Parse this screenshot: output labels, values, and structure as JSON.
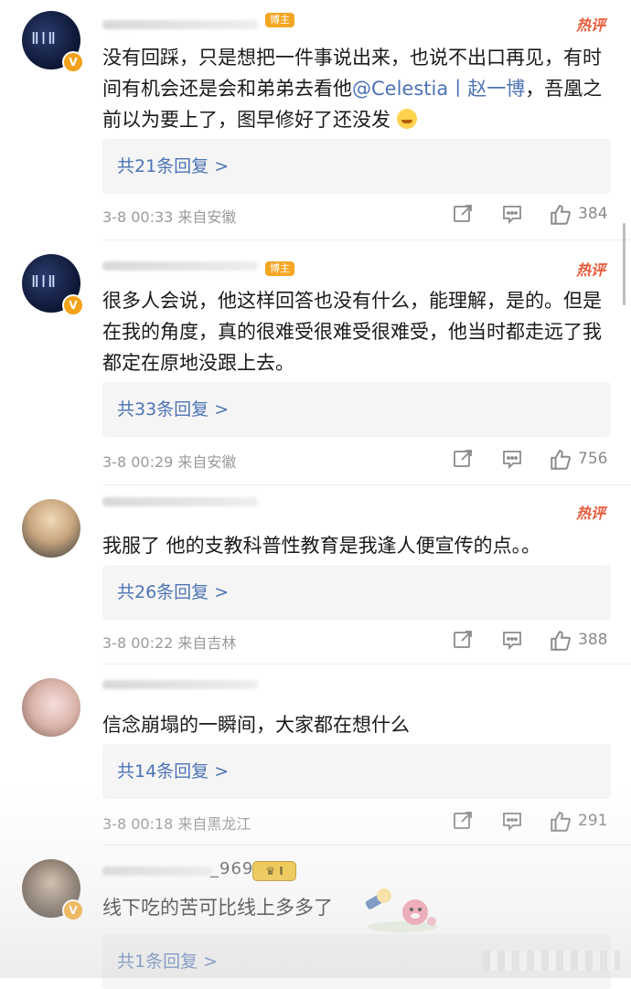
{
  "hot_label": "热评",
  "author_label": "博主",
  "comments": [
    {
      "text_pre": "没有回踩，只是想把一件事说出来，也说不出口再见，有时间有机会还是会和弟弟去看他",
      "mention": "@Celestia丨赵一博",
      "text_post": "，吾凰之前以为要上了，图早修好了还没发",
      "replies": "共21条回复 >",
      "meta": "3-8 00:33  来自安徽",
      "likes": "384"
    },
    {
      "text": "很多人会说，他这样回答也没有什么，能理解，是的。但是在我的角度，真的很难受很难受很难受，他当时都走远了我都定在原地没跟上去。",
      "replies": "共33条回复 >",
      "meta": "3-8 00:29  来自安徽",
      "likes": "756"
    },
    {
      "text": "我服了 他的支教科普性教育是我逢人便宣传的点。。",
      "replies": "共26条回复 >",
      "meta": "3-8 00:22  来自吉林",
      "likes": "388"
    },
    {
      "text": "信念崩塌的一瞬间，大家都在想什么",
      "replies": "共14条回复 >",
      "meta": "3-8 00:18  来自黑龙江",
      "likes": "291"
    },
    {
      "name_partial": "_9697",
      "level": "I",
      "text": "线下吃的苦可比线上多多了",
      "replies": "共1条回复 >"
    }
  ],
  "icons": {
    "share": "share-icon",
    "comment": "comment-icon",
    "like": "thumbs-up-icon"
  }
}
